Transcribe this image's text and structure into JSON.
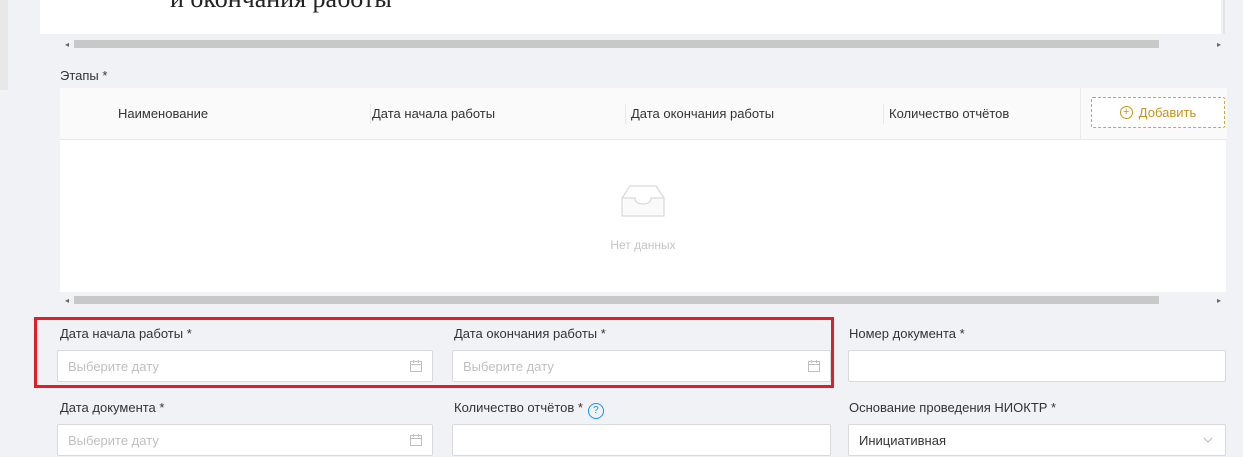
{
  "top_text": "и окончания работы",
  "stages": {
    "label": "Этапы *",
    "columns": [
      "Наименование",
      "Дата начала работы",
      "Дата окончания работы",
      "Количество отчётов"
    ],
    "add_button": "Добавить",
    "empty_text": "Нет данных"
  },
  "scroll_arrows": {
    "left": "◂",
    "right": "▸"
  },
  "form": {
    "start_date": {
      "label": "Дата начала работы *",
      "placeholder": "Выберите дату"
    },
    "end_date": {
      "label": "Дата окончания работы *",
      "placeholder": "Выберите дату"
    },
    "doc_number": {
      "label": "Номер документа *",
      "value": ""
    },
    "doc_date": {
      "label": "Дата документа *",
      "placeholder": "Выберите дату"
    },
    "reports_count": {
      "label": "Количество отчётов *",
      "help_icon": "?",
      "value": ""
    },
    "basis": {
      "label": "Основание проведения НИОКТР *",
      "value": "Инициативная"
    }
  },
  "colors": {
    "accent": "#c4931e",
    "highlight": "#e11d2a",
    "help": "#1890ff"
  },
  "icons": [
    "calendar-icon",
    "chevron-down-icon",
    "empty-box-icon",
    "plus-circle-icon",
    "question-circle-icon"
  ]
}
